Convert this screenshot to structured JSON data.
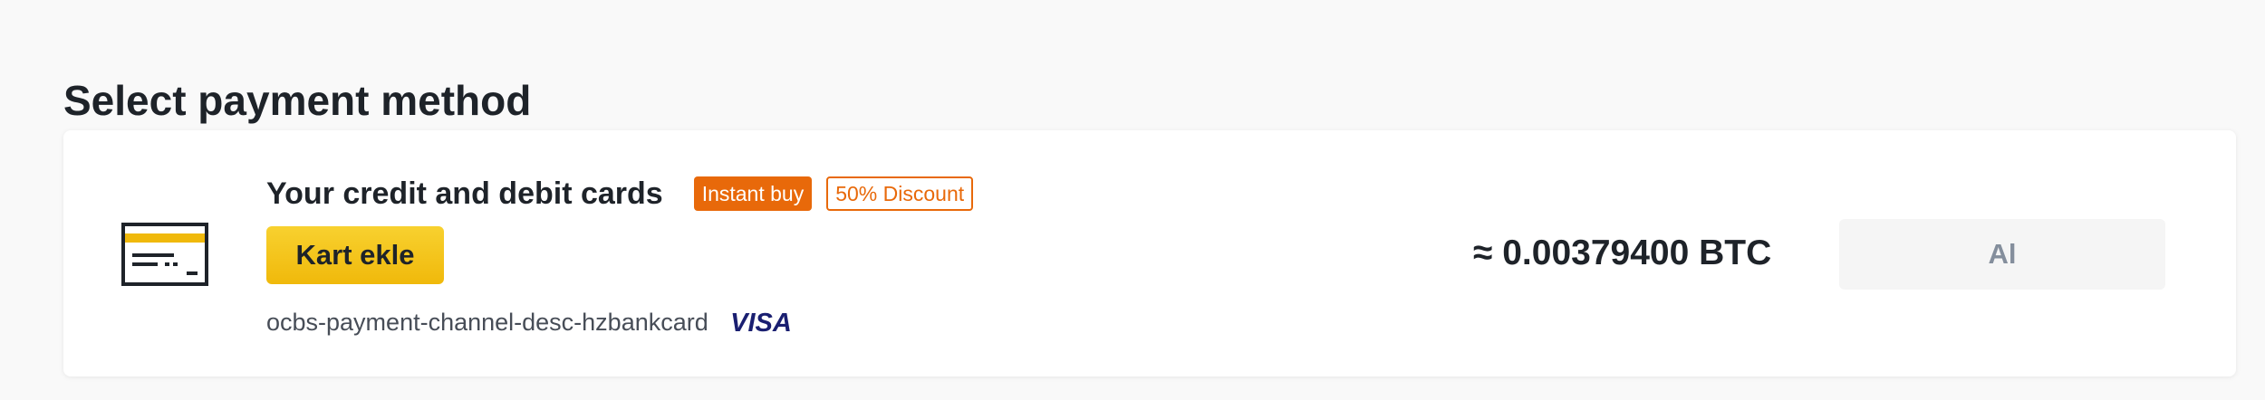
{
  "page": {
    "title": "Select payment method"
  },
  "payment_option": {
    "icon": "credit-card-icon",
    "title": "Your credit and debit cards",
    "badges": {
      "instant": "Instant buy",
      "discount": "50% Discount"
    },
    "add_card_label": "Kart ekle",
    "description": "ocbs-payment-channel-desc-hzbankcard",
    "brand_logo": "VISA",
    "price": "≈ 0.00379400 BTC",
    "buy_label": "Al"
  },
  "colors": {
    "accent_yellow": "#f0b90b",
    "badge_orange": "#e8690a",
    "visa_blue": "#1a1f71",
    "disabled_text": "#848e9c"
  }
}
